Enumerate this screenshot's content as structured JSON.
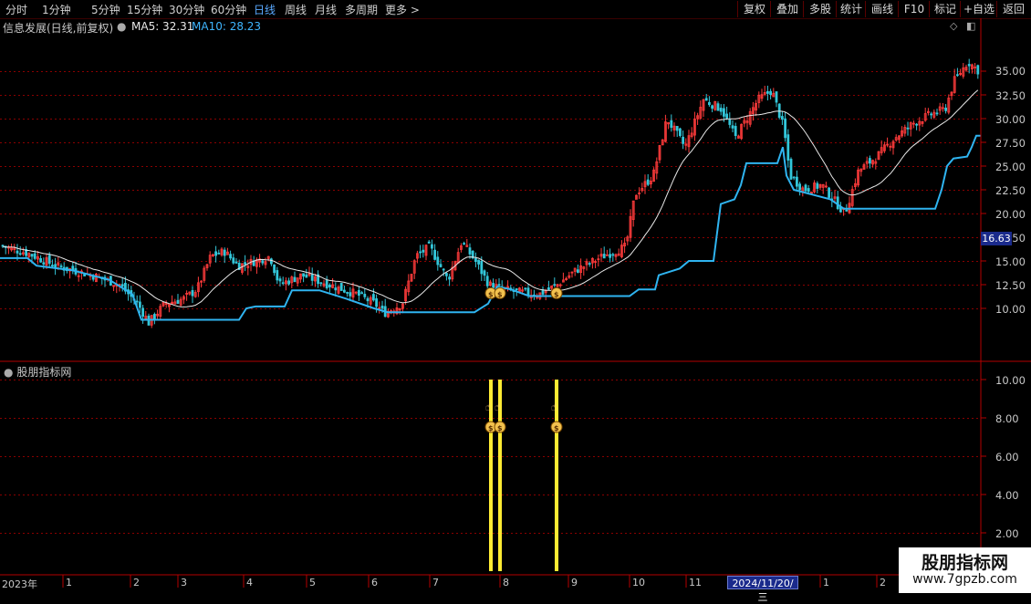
{
  "toolbar": {
    "periods": [
      "分时",
      "1分钟",
      "5分钟",
      "15分钟",
      "30分钟",
      "60分钟",
      "日线",
      "周线",
      "月线",
      "多周期",
      "更多 >"
    ],
    "active_period": "日线",
    "right_buttons": [
      "复权",
      "叠加",
      "多股",
      "统计",
      "画线",
      "F10",
      "标记",
      "+自选",
      "返回"
    ]
  },
  "info": {
    "title": "信息发展(日线,前复权)",
    "ma5": "MA5: 32.31",
    "ma10": "MA10: 28.23"
  },
  "colors": {
    "up": "#ff3b3b",
    "down": "#33c6d9",
    "stop_line": "#2fb4f0",
    "ma_line": "#e8e8e8",
    "signal": "#ffeb33",
    "grid": "#8a0000",
    "axis": "#b40000"
  },
  "price_axis": {
    "labels": [
      "35.00",
      "32.50",
      "30.00",
      "27.50",
      "25.00",
      "22.50",
      "20.00",
      "17.50",
      "15.00",
      "12.50",
      "10.00"
    ],
    "current_price": "16.63"
  },
  "indicator": {
    "title": "股朋指标网",
    "labels": [
      "10.00",
      "8.00",
      "6.00",
      "4.00",
      "2.00"
    ],
    "signal_icons": [
      "pointer-hand-icon",
      "money-bag-icon"
    ]
  },
  "chart_data": {
    "type": "candlestick",
    "ylim": [
      8,
      37.5
    ],
    "series": [
      {
        "name": "MA5",
        "value": 32.31
      },
      {
        "name": "MA10",
        "value": 28.23
      }
    ],
    "key_points": [
      {
        "x": "2023-01",
        "close": 16.5
      },
      {
        "x": "2023-02",
        "close": 8.5
      },
      {
        "x": "2023-03",
        "close": 11.0
      },
      {
        "x": "2023-04",
        "close": 15.5
      },
      {
        "x": "2023-05",
        "close": 12.5
      },
      {
        "x": "2023-06",
        "close": 10.0
      },
      {
        "x": "2023-07",
        "close": 16.0
      },
      {
        "x": "2023-08",
        "close": 12.0
      },
      {
        "x": "2023-09",
        "close": 12.5
      },
      {
        "x": "2023-10",
        "close": 17.0
      },
      {
        "x": "2023-11",
        "close": 33.0
      },
      {
        "x": "2023-12",
        "close": 23.0
      },
      {
        "x": "2024-01",
        "close": 20.0
      },
      {
        "x": "2024-02",
        "close": 35.0
      }
    ],
    "indicator_signals": [
      {
        "x": "2023-07",
        "value": 10
      },
      {
        "x": "2023-08",
        "value": 10
      },
      {
        "x": "2023-08",
        "value": 10
      }
    ],
    "indicator_ylim": [
      0,
      10.5
    ]
  },
  "x_axis": {
    "labels": [
      "2023年",
      "1",
      "2",
      "3",
      "4",
      "5",
      "6",
      "7",
      "8",
      "9",
      "10",
      "11",
      "1",
      "2"
    ],
    "cursor_date": "2024/11/20/三"
  },
  "watermark": {
    "title": "股朋指标网",
    "url": "www.7gpzb.com"
  }
}
